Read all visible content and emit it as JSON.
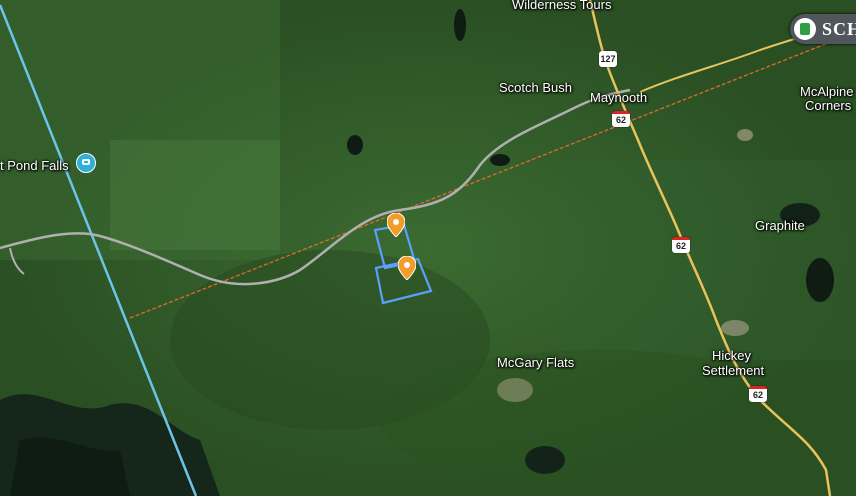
{
  "map": {
    "view": "satellite",
    "terrain_color": "#2d5a27",
    "place_labels": {
      "wilderness_tours": "Wilderness Tours",
      "scotch_bush": "Scotch Bush",
      "maynooth": "Maynooth",
      "mcalpine_corners_line1": "McAlpine",
      "mcalpine_corners_line2": "Corners",
      "pond_falls": "t Pond Falls",
      "graphite": "Graphite",
      "mcgary_flats": "McGary Flats",
      "hickey_line1": "Hickey",
      "hickey_line2": "Settlement"
    },
    "routes": {
      "hwy_127": "127",
      "hwy_62_a": "62",
      "hwy_62_b": "62",
      "hwy_62_c": "62"
    },
    "brand_badge": {
      "text": "SCH",
      "icon": "house-logo-icon"
    },
    "markers": [
      {
        "name": "property-pin-north",
        "color": "#f39c27"
      },
      {
        "name": "property-pin-south",
        "color": "#f39c27"
      }
    ],
    "parcel_outline_color": "#5aa0ff",
    "road_colors": {
      "highway": "#e8c25a",
      "trail": "#a9a9a9",
      "rail": "#e06b2a",
      "boundary": "#6cc4e8"
    }
  }
}
